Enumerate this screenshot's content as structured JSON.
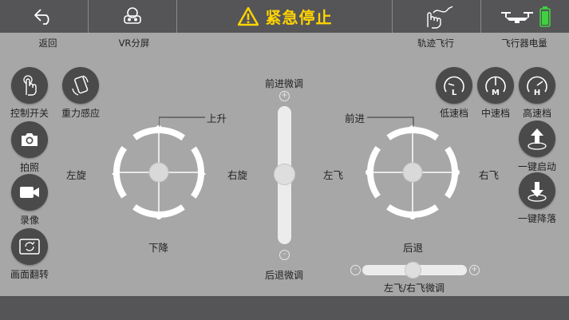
{
  "topbar": {
    "back_label": "返回",
    "vr_label": "VR分屏",
    "estop_label": "紧急停止",
    "trajectory_label": "轨迹飞行",
    "battery_label": "飞行器电量"
  },
  "left_buttons": {
    "control_switch": "控制开关",
    "gravity": "重力感应",
    "photo": "拍照",
    "record": "录像",
    "flip": "画面翻转"
  },
  "left_joystick": {
    "up": "上升",
    "down": "下降",
    "left": "左旋",
    "right": "右旋"
  },
  "center_trim": {
    "top": "前进微调",
    "bottom": "后退微调"
  },
  "right_joystick": {
    "up": "前进",
    "down": "后退",
    "left": "左飞",
    "right": "右飞",
    "trim": "左飞/右飞微调"
  },
  "speed": {
    "low": "低速档",
    "mid": "中速档",
    "high": "高速档",
    "low_letter": "L",
    "mid_letter": "M",
    "high_letter": "H"
  },
  "actions": {
    "takeoff": "一键启动",
    "land": "一键降落"
  },
  "colors": {
    "bar": "#555557",
    "bg": "#a7a7a7",
    "accent": "#ffd400",
    "battery": "#3fd13f"
  }
}
